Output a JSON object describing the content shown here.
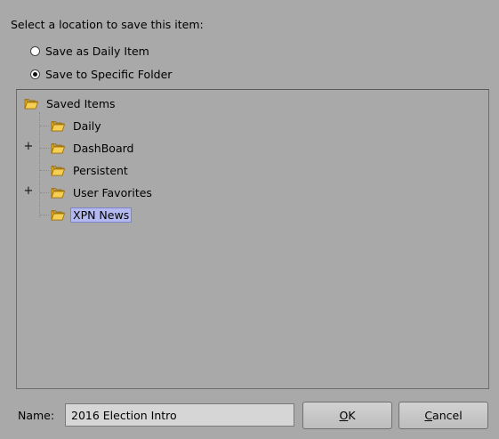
{
  "prompt": "Select a location to save this item:",
  "options": [
    {
      "label": "Save as Daily Item",
      "checked": false
    },
    {
      "label": "Save to Specific Folder",
      "checked": true
    }
  ],
  "tree": {
    "root": "Saved Items",
    "children": [
      {
        "label": "Daily",
        "expandable": false,
        "selected": false
      },
      {
        "label": "DashBoard",
        "expandable": true,
        "expander": "+",
        "selected": false
      },
      {
        "label": "Persistent",
        "expandable": false,
        "selected": false
      },
      {
        "label": "User Favorites",
        "expandable": true,
        "expander": "+",
        "selected": false
      },
      {
        "label": "XPN News",
        "expandable": false,
        "selected": true
      }
    ]
  },
  "name_field": {
    "label": "Name:",
    "value": "2016 Election Intro"
  },
  "buttons": {
    "ok": {
      "mnemonic": "O",
      "rest": "K"
    },
    "cancel": {
      "mnemonic": "C",
      "rest": "ancel"
    }
  },
  "colors": {
    "selection": "#b3b8ee",
    "folder": "#f1c232"
  }
}
